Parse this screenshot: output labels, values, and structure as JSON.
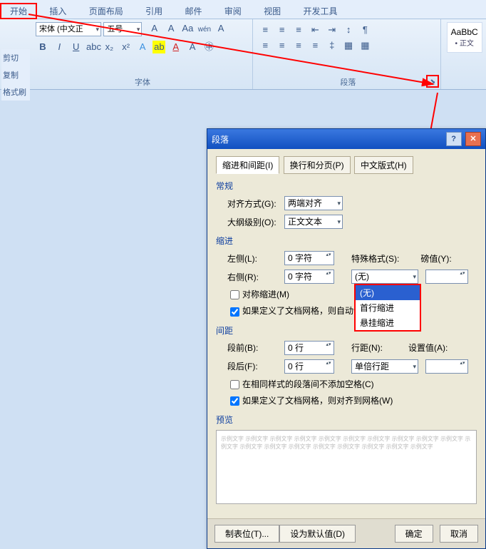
{
  "tabs": {
    "start": "开始",
    "insert": "插入",
    "layout": "页面布局",
    "ref": "引用",
    "mail": "邮件",
    "review": "审阅",
    "view": "视图",
    "dev": "开发工具"
  },
  "quick": {
    "cut": "剪切",
    "copy": "复制",
    "fmt": "格式刷"
  },
  "font": {
    "name": "宋体 (中文正",
    "size": "五号",
    "group": "字体"
  },
  "para": {
    "group": "段落"
  },
  "styles": {
    "sample": "AaBbC",
    "normal": "• 正文"
  },
  "dlg": {
    "title": "段落",
    "tab1": "缩进和间距(I)",
    "tab2": "换行和分页(P)",
    "tab3": "中文版式(H)",
    "general": "常规",
    "align_lbl": "对齐方式(G):",
    "align_val": "两端对齐",
    "outline_lbl": "大纲级别(O):",
    "outline_val": "正文文本",
    "indent": "缩进",
    "left_lbl": "左侧(L):",
    "left_val": "0 字符",
    "right_lbl": "右侧(R):",
    "right_val": "0 字符",
    "special_lbl": "特殊格式(S):",
    "special_val": "(无)",
    "by_lbl": "磅值(Y):",
    "mirror": "对称缩进(M)",
    "autogrid1": "如果定义了文档网格，则自动调",
    "dd": {
      "none": "(无)",
      "first": "首行缩进",
      "hang": "悬挂缩进"
    },
    "spacing": "间距",
    "before_lbl": "段前(B):",
    "before_val": "0 行",
    "after_lbl": "段后(F):",
    "after_val": "0 行",
    "line_lbl": "行距(N):",
    "line_val": "单倍行距",
    "at_lbl": "设置值(A):",
    "nospacesame": "在相同样式的段落间不添加空格(C)",
    "snapgrid": "如果定义了文档网格，则对齐到网格(W)",
    "preview": "预览",
    "preview_text": "示例文字 示例文字 示例文字 示例文字 示例文字 示例文字 示例文字 示例文字 示例文字 示例文字 示例文字 示例文字 示例文字 示例文字 示例文字 示例文字 示例文字 示例文字 示例文字",
    "tabstops": "制表位(T)...",
    "default": "设为默认值(D)",
    "ok": "确定",
    "cancel": "取消"
  }
}
